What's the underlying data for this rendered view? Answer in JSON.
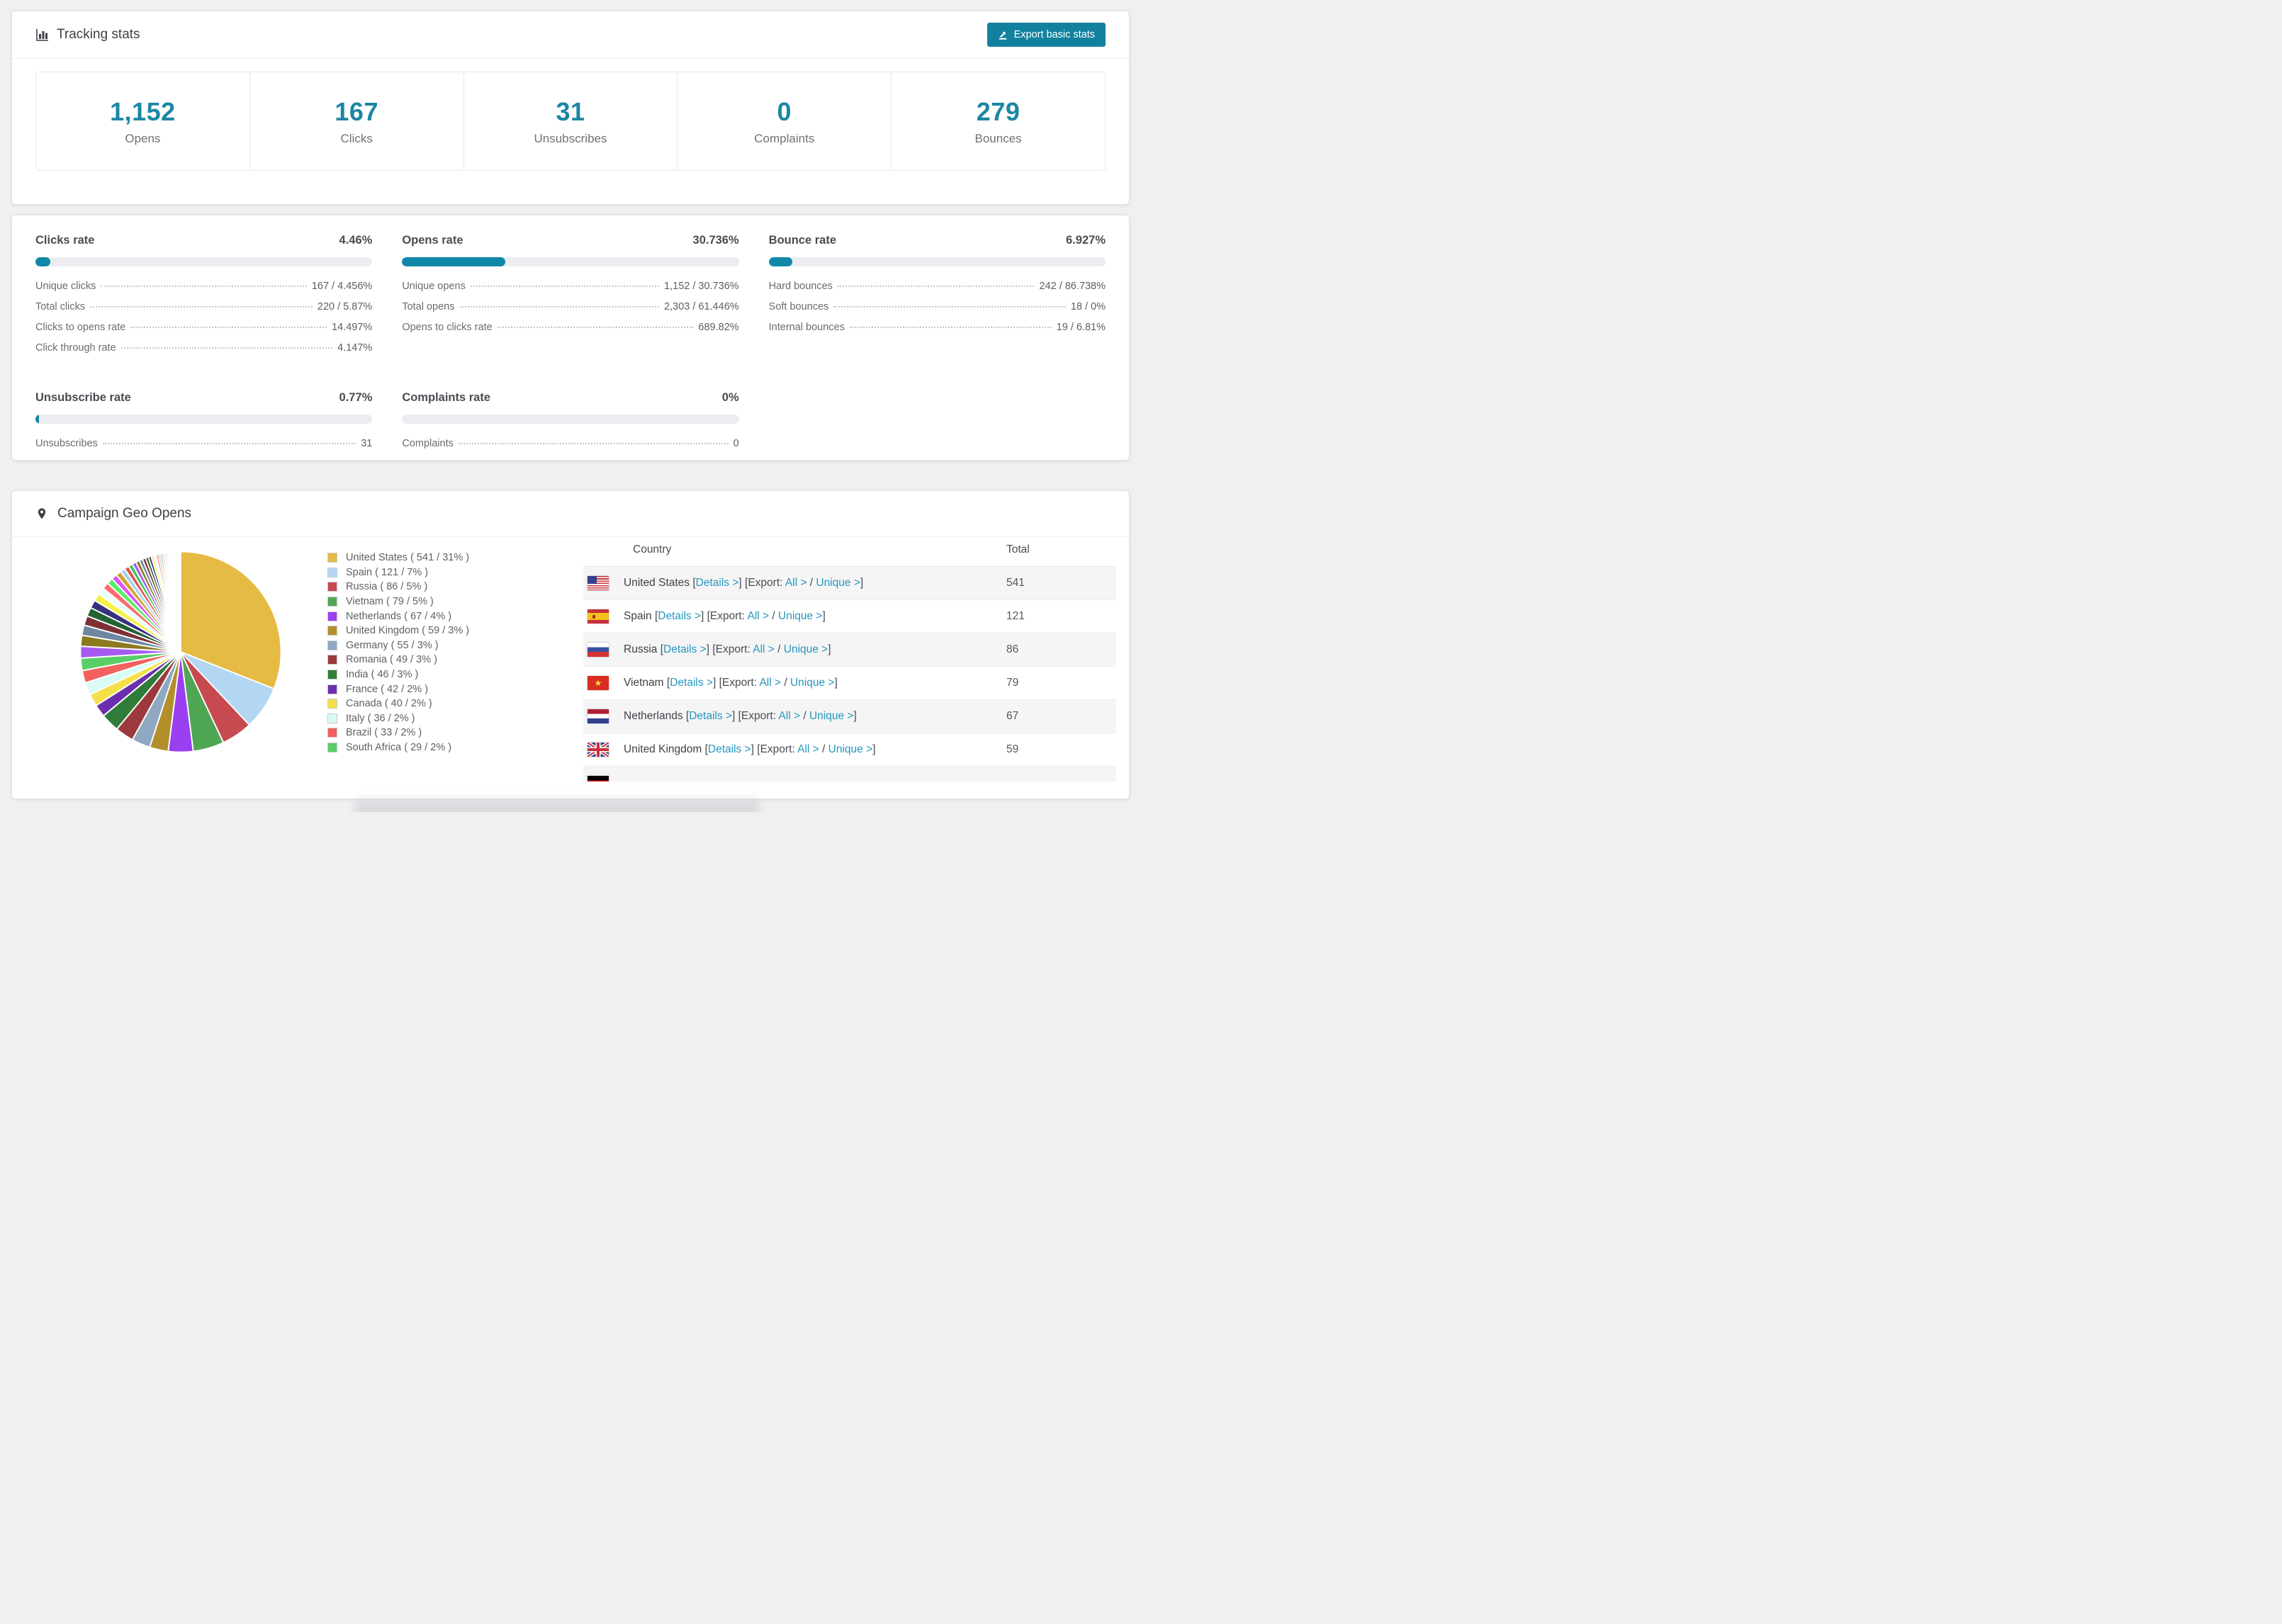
{
  "accent": "#1088a8",
  "link_color": "#2597bd",
  "tracking": {
    "title": "Tracking stats",
    "export_button": "Export basic stats",
    "stats": [
      {
        "value": "1,152",
        "label": "Opens"
      },
      {
        "value": "167",
        "label": "Clicks"
      },
      {
        "value": "31",
        "label": "Unsubscribes"
      },
      {
        "value": "0",
        "label": "Complaints"
      },
      {
        "value": "279",
        "label": "Bounces"
      }
    ]
  },
  "rates": [
    {
      "title": "Clicks rate",
      "value": "4.46%",
      "percent": 4.46,
      "rows": [
        [
          "Unique clicks",
          "167 / 4.456%"
        ],
        [
          "Total clicks",
          "220 / 5.87%"
        ],
        [
          "Clicks to opens rate",
          "14.497%"
        ],
        [
          "Click through rate",
          "4.147%"
        ]
      ]
    },
    {
      "title": "Opens rate",
      "value": "30.736%",
      "percent": 30.736,
      "rows": [
        [
          "Unique opens",
          "1,152 / 30.736%"
        ],
        [
          "Total opens",
          "2,303 / 61.446%"
        ],
        [
          "Opens to clicks rate",
          "689.82%"
        ]
      ]
    },
    {
      "title": "Bounce rate",
      "value": "6.927%",
      "percent": 6.927,
      "rows": [
        [
          "Hard bounces",
          "242 / 86.738%"
        ],
        [
          "Soft bounces",
          "18 / 0%"
        ],
        [
          "Internal bounces",
          "19 / 6.81%"
        ]
      ]
    },
    {
      "title": "Unsubscribe rate",
      "value": "0.77%",
      "percent": 0.77,
      "rows": [
        [
          "Unsubscribes",
          "31"
        ]
      ]
    },
    {
      "title": "Complaints rate",
      "value": "0%",
      "percent": 0,
      "rows": [
        [
          "Complaints",
          "0"
        ]
      ]
    }
  ],
  "geo": {
    "title": "Campaign Geo Opens",
    "chart_data": {
      "type": "pie",
      "title": "Campaign Geo Opens",
      "legend_position": "right",
      "start_angle_deg": 0,
      "direction": "clockwise",
      "slices": [
        {
          "label": "United States",
          "value": 541,
          "percent": 31,
          "color": "#e5bb44",
          "flag": "us"
        },
        {
          "label": "Spain",
          "value": 121,
          "percent": 7,
          "color": "#b3d6f2",
          "flag": "es"
        },
        {
          "label": "Russia",
          "value": 86,
          "percent": 5,
          "color": "#c74a50",
          "flag": "ru"
        },
        {
          "label": "Vietnam",
          "value": 79,
          "percent": 5,
          "color": "#4fa653",
          "flag": "vn"
        },
        {
          "label": "Netherlands",
          "value": 67,
          "percent": 4,
          "color": "#9a3ff2",
          "flag": "nl"
        },
        {
          "label": "United Kingdom",
          "value": 59,
          "percent": 3,
          "color": "#b28f2b",
          "flag": "uk"
        },
        {
          "label": "Germany",
          "value": 55,
          "percent": 3,
          "color": "#8fa9c2",
          "flag": "de"
        },
        {
          "label": "Romania",
          "value": 49,
          "percent": 3,
          "color": "#9c393d"
        },
        {
          "label": "India",
          "value": 46,
          "percent": 3,
          "color": "#2f7d38"
        },
        {
          "label": "France",
          "value": 42,
          "percent": 2,
          "color": "#6b2fae"
        },
        {
          "label": "Canada",
          "value": 40,
          "percent": 2,
          "color": "#f6e049"
        },
        {
          "label": "Italy",
          "value": 36,
          "percent": 2,
          "color": "#d9fbf6"
        },
        {
          "label": "Brazil",
          "value": 33,
          "percent": 2,
          "color": "#f2615e"
        },
        {
          "label": "South Africa",
          "value": 29,
          "percent": 2,
          "color": "#5ace66"
        }
      ],
      "others_percent": 26,
      "others_slice_count": 44,
      "tail_palette": [
        "#a75af2",
        "#8b7a1f",
        "#6f87a1",
        "#7d3033",
        "#226233",
        "#37307c",
        "#f6f148",
        "#e9fdfb",
        "#fb6b6b",
        "#57ef69",
        "#e253f2",
        "#d0a52f",
        "#a9d2f2",
        "#e55353",
        "#46c455"
      ]
    },
    "table": {
      "headers": [
        "Country",
        "Total"
      ],
      "link_labels": {
        "details": "Details >",
        "export_prefix": "Export:",
        "all": "All >",
        "unique": "Unique >"
      },
      "rows": [
        {
          "country": "United States",
          "total": "541",
          "flag": "us"
        },
        {
          "country": "Spain",
          "total": "121",
          "flag": "es"
        },
        {
          "country": "Russia",
          "total": "86",
          "flag": "ru"
        },
        {
          "country": "Vietnam",
          "total": "79",
          "flag": "vn"
        },
        {
          "country": "Netherlands",
          "total": "67",
          "flag": "nl"
        },
        {
          "country": "United Kingdom",
          "total": "59",
          "flag": "uk"
        }
      ],
      "partial_row": {
        "flag": "de"
      }
    }
  }
}
